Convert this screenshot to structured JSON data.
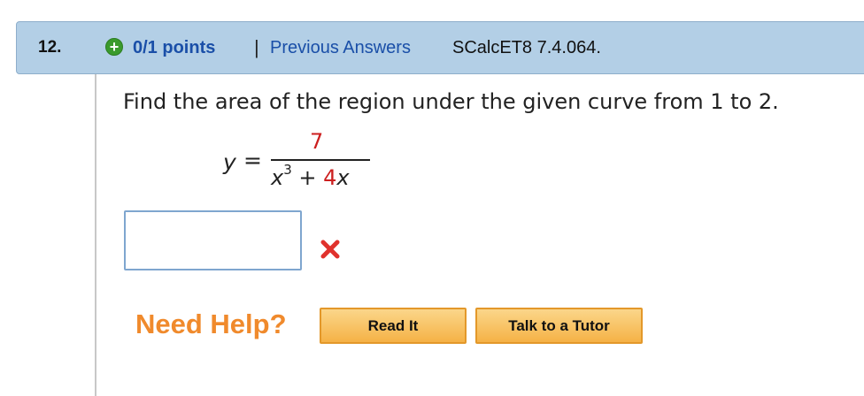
{
  "question": {
    "number": "12.",
    "points": "0/1 points",
    "separator": "|",
    "previous_answers": "Previous Answers",
    "code": "SCalcET8 7.4.064.",
    "prompt": "Find the area of the region under the given curve from 1 to 2."
  },
  "equation": {
    "lhs": "y",
    "equals": "=",
    "numerator": "7",
    "den_x": "x",
    "den_exp": "3",
    "den_plus": " + ",
    "den_coef": "4",
    "den_x2": "x"
  },
  "answer": {
    "value": "",
    "status": "incorrect"
  },
  "help": {
    "label": "Need Help?",
    "read_it": "Read It",
    "talk_tutor": "Talk to a Tutor"
  },
  "icons": {
    "status_plus": "plus-circle-icon",
    "incorrect": "x-mark-icon"
  },
  "colors": {
    "header_bg": "#b3cfe6",
    "link": "#1a4fa8",
    "error_red": "#cc1f1f",
    "help_orange": "#f08a2c",
    "button": "#f5b246"
  }
}
